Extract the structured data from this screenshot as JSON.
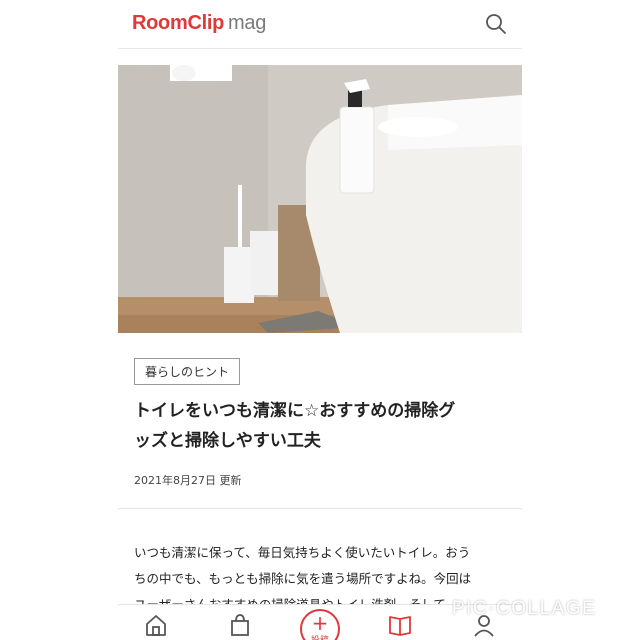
{
  "header": {
    "logo_brand": "RoomClip",
    "logo_suffix": "mag"
  },
  "article": {
    "category": "暮らしのヒント",
    "title_line1": "トイレをいつも清潔に☆おすすめの掃除グ",
    "title_line2": "ッズと掃除しやすい工夫",
    "date": "2021年8月27日 更新",
    "body_line1": "いつも清潔に保って、毎日気持ちよく使いたいトイレ。おう",
    "body_line2": "ちの中でも、もっとも掃除に気を遣う場所ですよね。今回は",
    "body_line3": "ユーザーさんおすすめの掃除道具やトイレ洗剤、そして"
  },
  "tabbar": {
    "post_label": "投稿",
    "icons": [
      "home-icon",
      "shopping-bag-icon",
      "post-plus-icon",
      "magazine-icon",
      "profile-icon"
    ]
  },
  "colors": {
    "brand": "#e0393a",
    "text": "#222222",
    "muted": "#7a7a7a"
  },
  "watermark": "PIC·COLLAGE"
}
